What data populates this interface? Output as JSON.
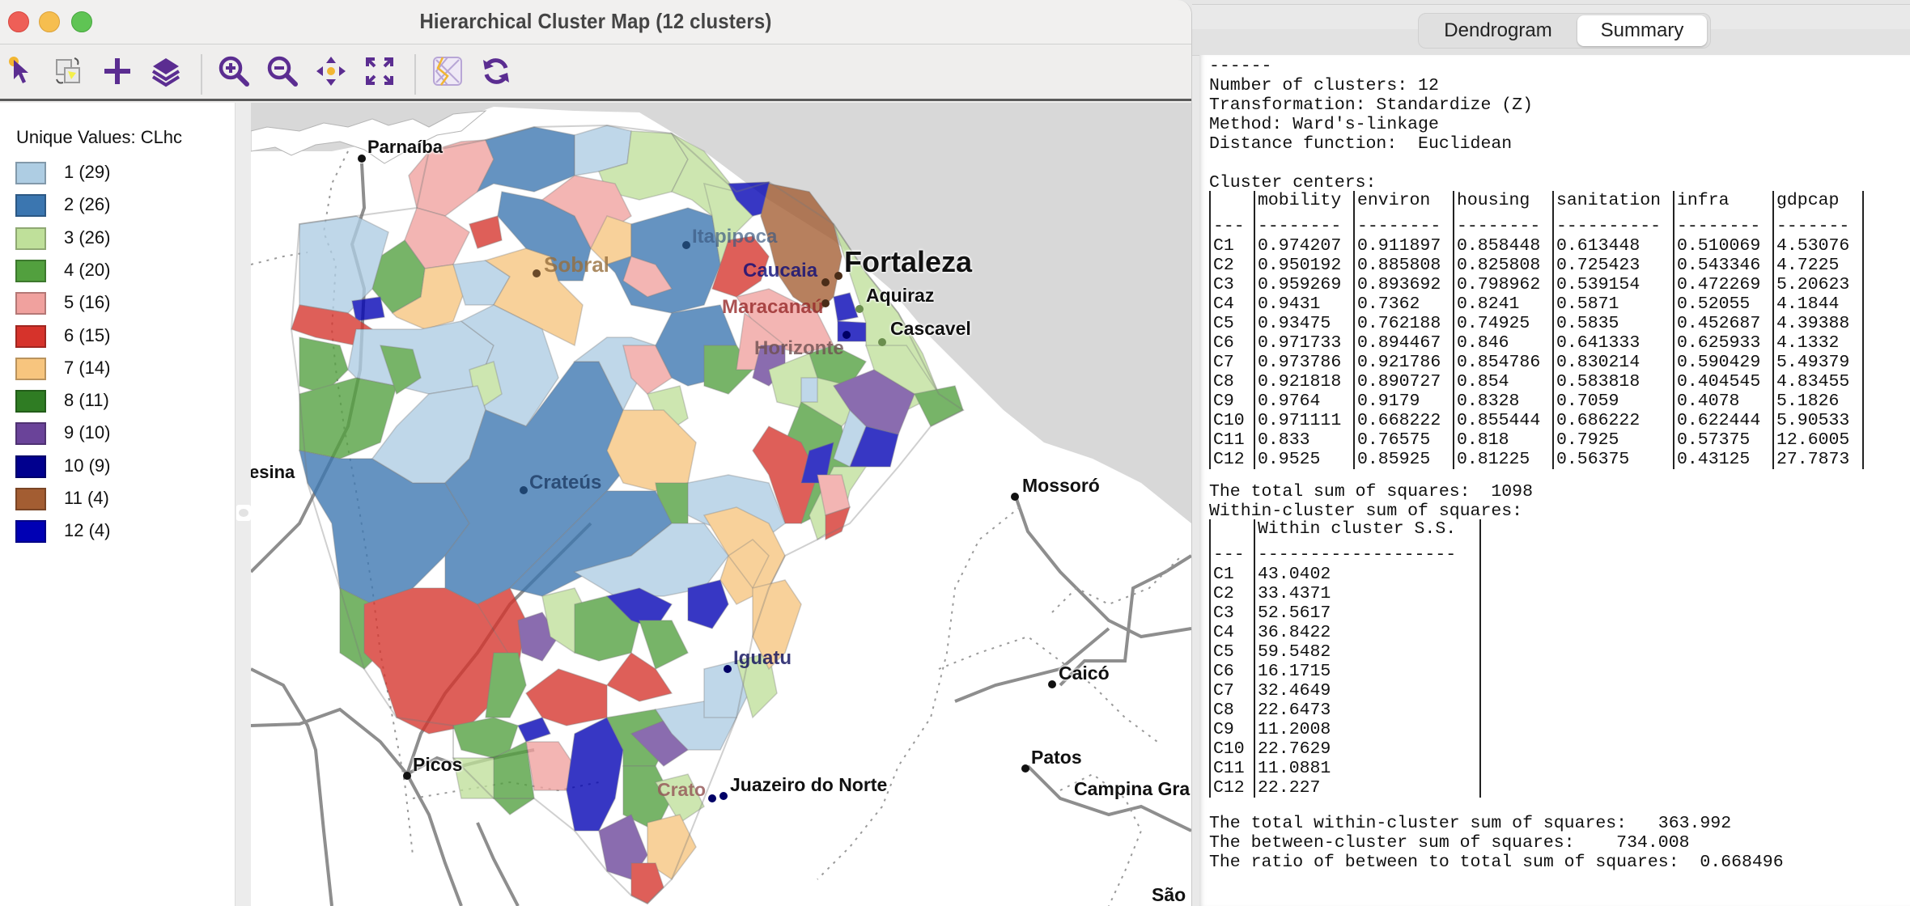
{
  "map_window": {
    "title": "Hierarchical Cluster Map (12 clusters)",
    "toolbar": [
      {
        "name": "select-tool-icon",
        "label": "Select"
      },
      {
        "name": "copy-selection-icon",
        "label": "Selection shape"
      },
      {
        "name": "add-layer-icon",
        "label": "Add"
      },
      {
        "name": "layers-icon",
        "label": "Layers"
      },
      {
        "name": "zoom-in-icon",
        "label": "Zoom In"
      },
      {
        "name": "zoom-out-icon",
        "label": "Zoom Out"
      },
      {
        "name": "pan-icon",
        "label": "Pan"
      },
      {
        "name": "full-extent-icon",
        "label": "Full Extent"
      },
      {
        "name": "basemap-icon",
        "label": "Basemap"
      },
      {
        "name": "refresh-icon",
        "label": "Refresh"
      }
    ],
    "legend": {
      "title": "Unique Values: CLhc",
      "items": [
        {
          "label": "1 (29)",
          "color": "#aecde3"
        },
        {
          "label": "2 (26)",
          "color": "#3b76b0"
        },
        {
          "label": "3 (26)",
          "color": "#bfe09a"
        },
        {
          "label": "4 (20)",
          "color": "#52a03e"
        },
        {
          "label": "5 (16)",
          "color": "#f0a19e"
        },
        {
          "label": "6 (15)",
          "color": "#d6332b"
        },
        {
          "label": "7 (14)",
          "color": "#f7c57e"
        },
        {
          "label": "8 (11)",
          "color": "#2f7c23"
        },
        {
          "label": "9 (10)",
          "color": "#6a4399"
        },
        {
          "label": "10 (9)",
          "color": "#01008e"
        },
        {
          "label": "11 (4)",
          "color": "#a35d32"
        },
        {
          "label": "12 (4)",
          "color": "#0000b4"
        }
      ]
    },
    "map_labels": {
      "parnaiba": "Parnaíba",
      "itapipoca": "Itapipoca",
      "sobral": "Sobral",
      "caucaia": "Caucaia",
      "fortaleza": "Fortaleza",
      "aquiraz": "Aquiraz",
      "maracanau": "Maracanaú",
      "cascavel": "Cascavel",
      "horizonte": "Horizonte",
      "teresina": "esina",
      "crateus": "Crateús",
      "mossoro": "Mossoró",
      "iguatu": "Iguatu",
      "caico": "Caicó",
      "picos": "Picos",
      "patos": "Patos",
      "crato": "Crato",
      "juazeiro": "Juazeiro do Norte",
      "campina_grande": "Campina Gra",
      "sao": "São"
    }
  },
  "summary_window": {
    "tabs": [
      {
        "label": "Dendrogram",
        "active": false
      },
      {
        "label": "Summary",
        "active": true
      }
    ],
    "header_rule": "------",
    "number_of_clusters": "Number of clusters: 12",
    "transformation": "Transformation: Standardize (Z)",
    "method": "Method: Ward's-linkage",
    "distance": "Distance function:  Euclidean",
    "centers_title": "Cluster centers:",
    "centers_columns": [
      "",
      "mobility",
      "environ",
      "housing",
      "sanitation",
      "infra",
      "gdpcap"
    ],
    "centers_dashes": [
      "---",
      "--------",
      "--------",
      "--------",
      "----------",
      "--------",
      "-------"
    ],
    "centers_rows": [
      [
        "C1",
        "0.974207",
        "0.911897",
        "0.858448",
        "0.613448",
        "0.510069",
        "4.53076"
      ],
      [
        "C2",
        "0.950192",
        "0.885808",
        "0.825808",
        "0.725423",
        "0.543346",
        "4.7225"
      ],
      [
        "C3",
        "0.959269",
        "0.893692",
        "0.798962",
        "0.539154",
        "0.472269",
        "5.20623"
      ],
      [
        "C4",
        "0.9431",
        "0.7362",
        "0.8241",
        "0.5871",
        "0.52055",
        "4.1844"
      ],
      [
        "C5",
        "0.93475",
        "0.762188",
        "0.74925",
        "0.5835",
        "0.452687",
        "4.39388"
      ],
      [
        "C6",
        "0.971733",
        "0.894467",
        "0.846",
        "0.641333",
        "0.625933",
        "4.1332"
      ],
      [
        "C7",
        "0.973786",
        "0.921786",
        "0.854786",
        "0.830214",
        "0.590429",
        "5.49379"
      ],
      [
        "C8",
        "0.921818",
        "0.890727",
        "0.854",
        "0.583818",
        "0.404545",
        "4.83455"
      ],
      [
        "C9",
        "0.9764",
        "0.9179",
        "0.8328",
        "0.7059",
        "0.4078",
        "5.1826"
      ],
      [
        "C10",
        "0.971111",
        "0.668222",
        "0.855444",
        "0.686222",
        "0.622444",
        "5.90533"
      ],
      [
        "C11",
        "0.833",
        "0.76575",
        "0.818",
        "0.7925",
        "0.57375",
        "12.6005"
      ],
      [
        "C12",
        "0.9525",
        "0.85925",
        "0.81225",
        "0.56375",
        "0.43125",
        "27.7873"
      ]
    ],
    "total_ss": "The total sum of squares:  1098",
    "within_title": "Within-cluster sum of squares:",
    "within_columns": [
      "",
      "Within cluster S.S."
    ],
    "within_dashes": [
      "---",
      "-------------------"
    ],
    "within_rows": [
      [
        "C1",
        "43.0402"
      ],
      [
        "C2",
        "33.4371"
      ],
      [
        "C3",
        "52.5617"
      ],
      [
        "C4",
        "36.8422"
      ],
      [
        "C5",
        "59.5482"
      ],
      [
        "C6",
        "16.1715"
      ],
      [
        "C7",
        "32.4649"
      ],
      [
        "C8",
        "22.6473"
      ],
      [
        "C9",
        "11.2008"
      ],
      [
        "C10",
        "22.7629"
      ],
      [
        "C11",
        "11.0881"
      ],
      [
        "C12",
        "22.227"
      ]
    ],
    "total_within": "The total within-cluster sum of squares:   363.992",
    "between": "The between-cluster sum of squares:    734.008",
    "ratio": "The ratio of between to total sum of squares:  0.668496"
  }
}
